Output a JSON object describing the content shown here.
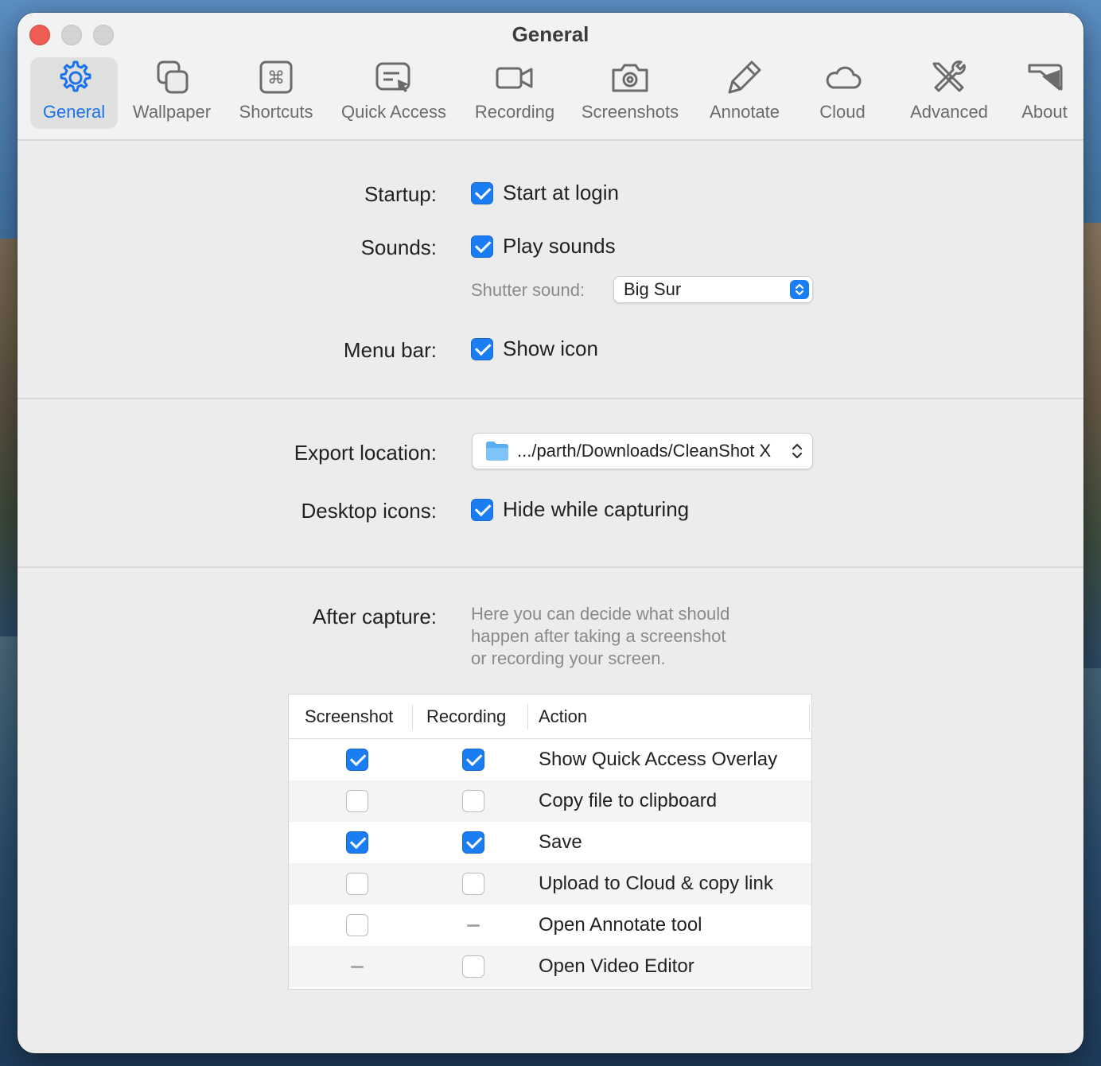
{
  "window": {
    "title": "General"
  },
  "toolbar": {
    "tabs": [
      {
        "label": "General",
        "icon": "gear-icon",
        "active": true
      },
      {
        "label": "Wallpaper",
        "icon": "wallpaper-icon",
        "active": false
      },
      {
        "label": "Shortcuts",
        "icon": "command-key-icon",
        "active": false
      },
      {
        "label": "Quick Access",
        "icon": "quick-access-icon",
        "active": false
      },
      {
        "label": "Recording",
        "icon": "video-camera-icon",
        "active": false
      },
      {
        "label": "Screenshots",
        "icon": "camera-icon",
        "active": false
      },
      {
        "label": "Annotate",
        "icon": "highlighter-icon",
        "active": false
      },
      {
        "label": "Cloud",
        "icon": "cloud-icon",
        "active": false
      },
      {
        "label": "Advanced",
        "icon": "tools-icon",
        "active": false
      },
      {
        "label": "About",
        "icon": "about-icon",
        "active": false
      }
    ]
  },
  "general": {
    "startup_label": "Startup:",
    "start_at_login": "Start at login",
    "sounds_label": "Sounds:",
    "play_sounds": "Play sounds",
    "shutter_sound_label": "Shutter sound:",
    "shutter_sound_value": "Big Sur",
    "menu_bar_label": "Menu bar:",
    "show_icon": "Show icon"
  },
  "export": {
    "location_label": "Export location:",
    "location_value": ".../parth/Downloads/CleanShot X",
    "desktop_icons_label": "Desktop icons:",
    "hide_while_capturing": "Hide while capturing"
  },
  "after_capture": {
    "label": "After capture:",
    "description": [
      "Here you can decide what should",
      "happen after taking a screenshot",
      "or recording your screen."
    ],
    "columns": [
      "Screenshot",
      "Recording",
      "Action"
    ],
    "rows": [
      {
        "screenshot": "checked",
        "recording": "checked",
        "action": "Show Quick Access Overlay"
      },
      {
        "screenshot": "unchecked",
        "recording": "unchecked",
        "action": "Copy file to clipboard"
      },
      {
        "screenshot": "checked",
        "recording": "checked",
        "action": "Save"
      },
      {
        "screenshot": "unchecked",
        "recording": "unchecked",
        "action": "Upload to Cloud & copy link"
      },
      {
        "screenshot": "unchecked",
        "recording": "unavailable",
        "action": "Open Annotate tool"
      },
      {
        "screenshot": "unavailable",
        "recording": "unchecked",
        "action": "Open Video Editor"
      }
    ]
  },
  "colors": {
    "accent": "#1a7ef2",
    "close": "#ee5c54"
  }
}
